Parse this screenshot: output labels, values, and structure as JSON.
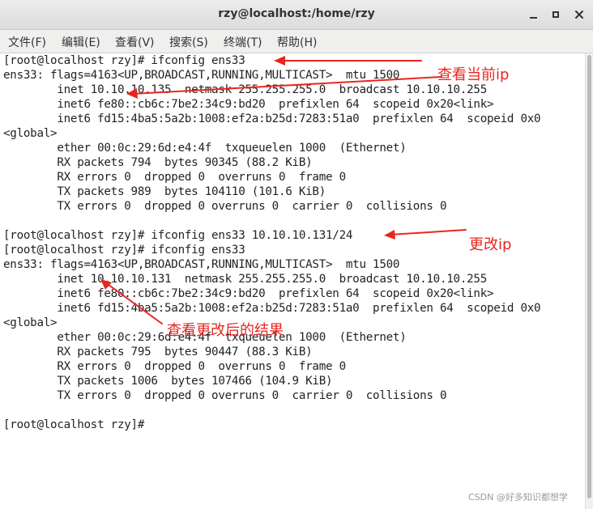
{
  "window": {
    "title": "rzy@localhost:/home/rzy"
  },
  "menu": {
    "items": [
      {
        "label": "文件(F)"
      },
      {
        "label": "编辑(E)"
      },
      {
        "label": "查看(V)"
      },
      {
        "label": "搜索(S)"
      },
      {
        "label": "终端(T)"
      },
      {
        "label": "帮助(H)"
      }
    ]
  },
  "terminal": {
    "lines": [
      "[root@localhost rzy]# ifconfig ens33",
      "ens33: flags=4163<UP,BROADCAST,RUNNING,MULTICAST>  mtu 1500",
      "        inet 10.10.10.135  netmask 255.255.255.0  broadcast 10.10.10.255",
      "        inet6 fe80::cb6c:7be2:34c9:bd20  prefixlen 64  scopeid 0x20<link>",
      "        inet6 fd15:4ba5:5a2b:1008:ef2a:b25d:7283:51a0  prefixlen 64  scopeid 0x0",
      "<global>",
      "        ether 00:0c:29:6d:e4:4f  txqueuelen 1000  (Ethernet)",
      "        RX packets 794  bytes 90345 (88.2 KiB)",
      "        RX errors 0  dropped 0  overruns 0  frame 0",
      "        TX packets 989  bytes 104110 (101.6 KiB)",
      "        TX errors 0  dropped 0 overruns 0  carrier 0  collisions 0",
      "",
      "[root@localhost rzy]# ifconfig ens33 10.10.10.131/24",
      "[root@localhost rzy]# ifconfig ens33",
      "ens33: flags=4163<UP,BROADCAST,RUNNING,MULTICAST>  mtu 1500",
      "        inet 10.10.10.131  netmask 255.255.255.0  broadcast 10.10.10.255",
      "        inet6 fe80::cb6c:7be2:34c9:bd20  prefixlen 64  scopeid 0x20<link>",
      "        inet6 fd15:4ba5:5a2b:1008:ef2a:b25d:7283:51a0  prefixlen 64  scopeid 0x0",
      "<global>",
      "        ether 00:0c:29:6d:e4:4f  txqueuelen 1000  (Ethernet)",
      "        RX packets 795  bytes 90447 (88.3 KiB)",
      "        RX errors 0  dropped 0  overruns 0  frame 0",
      "        TX packets 1006  bytes 107466 (104.9 KiB)",
      "        TX errors 0  dropped 0 overruns 0  carrier 0  collisions 0",
      "",
      "[root@localhost rzy]# "
    ]
  },
  "annotations": {
    "current_ip": "查看当前ip",
    "change_ip": "更改ip",
    "view_result": "查看更改后的结果",
    "color": "#e8261f"
  },
  "watermark": "CSDN @好多知识都想学"
}
